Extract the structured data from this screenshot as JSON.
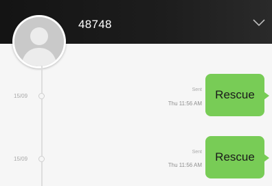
{
  "header": {
    "title": "48748",
    "avatar_icon": "person-silhouette-icon",
    "menu_icon": "chevron-down-icon"
  },
  "colors": {
    "header": "#1a1a1a",
    "bubble": "#78cc56",
    "background": "#f6f6f6"
  },
  "messages": [
    {
      "date": "15/09",
      "status": "Sent",
      "time": "Thu 11:56 AM",
      "text": "Rescue"
    },
    {
      "date": "15/09",
      "status": "Sent",
      "time": "Thu 11:56 AM",
      "text": "Rescue"
    }
  ]
}
